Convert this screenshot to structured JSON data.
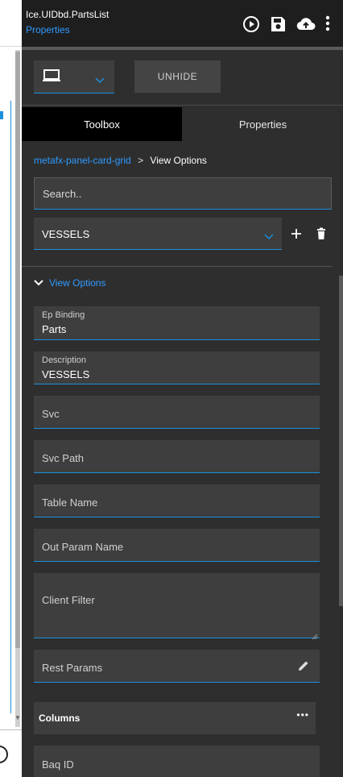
{
  "header": {
    "title": "Ice.UIDbd.PartsList",
    "subtitle": "Properties",
    "icons": [
      "play-circle-icon",
      "save-icon",
      "cloud-upload-icon",
      "more-vert-icon"
    ]
  },
  "toolbar": {
    "device_icon": "laptop-icon",
    "unhide_label": "UNHIDE"
  },
  "tabs": [
    {
      "label": "Toolbox",
      "active": true
    },
    {
      "label": "Properties",
      "active": false
    }
  ],
  "breadcrumb": {
    "link": "metafx-panel-card-grid",
    "separator": ">",
    "current": "View Options"
  },
  "search": {
    "placeholder": "Search.."
  },
  "vessel": {
    "value": "VESSELS"
  },
  "section": {
    "title": "View Options"
  },
  "fields": {
    "ep_binding": {
      "label": "Ep Binding",
      "value": "Parts"
    },
    "description": {
      "label": "Description",
      "value": "VESSELS"
    },
    "svc": {
      "label": "Svc"
    },
    "svc_path": {
      "label": "Svc Path"
    },
    "table_name": {
      "label": "Table Name"
    },
    "out_param_name": {
      "label": "Out Param Name"
    },
    "client_filter": {
      "label": "Client Filter"
    },
    "rest_params": {
      "label": "Rest Params"
    },
    "baq_id": {
      "label": "Baq ID"
    }
  },
  "columns": {
    "label": "Columns",
    "more": "•••"
  },
  "colors": {
    "accent": "#1a8fdc",
    "link": "#2f9bff",
    "panel_bg": "#2e2e2e",
    "field_bg": "#3e3e3e",
    "header_bg": "#1e1e1e"
  }
}
